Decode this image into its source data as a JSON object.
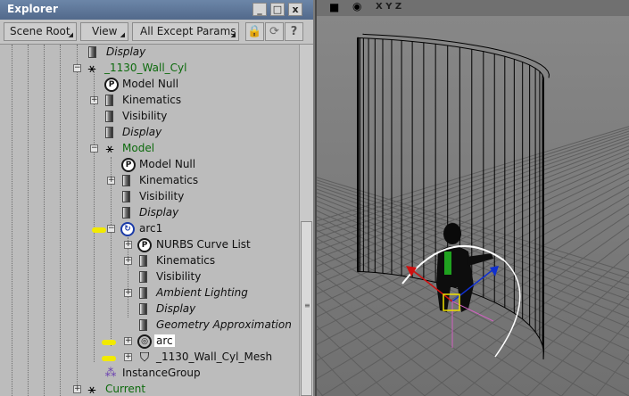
{
  "window": {
    "title": "Explorer"
  },
  "toolbar": {
    "scene_root": "Scene Root",
    "view": "View",
    "filter": "All Except Params"
  },
  "tree": [
    {
      "label": "Display",
      "style": "italic"
    },
    {
      "label": "_1130_Wall_Cyl",
      "style": "green"
    },
    {
      "label": "Model Null",
      "style": "normal"
    },
    {
      "label": "Kinematics",
      "style": "normal"
    },
    {
      "label": "Visibility",
      "style": "normal"
    },
    {
      "label": "Display",
      "style": "italic"
    },
    {
      "label": "Model",
      "style": "green"
    },
    {
      "label": "Model Null",
      "style": "normal"
    },
    {
      "label": "Kinematics",
      "style": "normal"
    },
    {
      "label": "Visibility",
      "style": "normal"
    },
    {
      "label": "Display",
      "style": "italic"
    },
    {
      "label": "arc1",
      "style": "normal"
    },
    {
      "label": "NURBS Curve List",
      "style": "normal"
    },
    {
      "label": "Kinematics",
      "style": "normal"
    },
    {
      "label": "Visibility",
      "style": "normal"
    },
    {
      "label": "Ambient Lighting",
      "style": "italic"
    },
    {
      "label": "Display",
      "style": "italic"
    },
    {
      "label": "Geometry Approximation",
      "style": "italic"
    },
    {
      "label": "arc",
      "style": "selected"
    },
    {
      "label": "_1130_Wall_Cyl_Mesh",
      "style": "normal"
    },
    {
      "label": "InstanceGroup",
      "style": "normal"
    },
    {
      "label": "Current",
      "style": "green"
    }
  ],
  "viewport": {
    "axes_label": "X Y Z"
  },
  "colors": {
    "panel_bg": "#bcbcbc",
    "title_bar": "#5d7799",
    "green_label": "#0c6a0c",
    "viewport_bg": "#7c7c7c",
    "highlight_marker": "#f2ea00"
  }
}
